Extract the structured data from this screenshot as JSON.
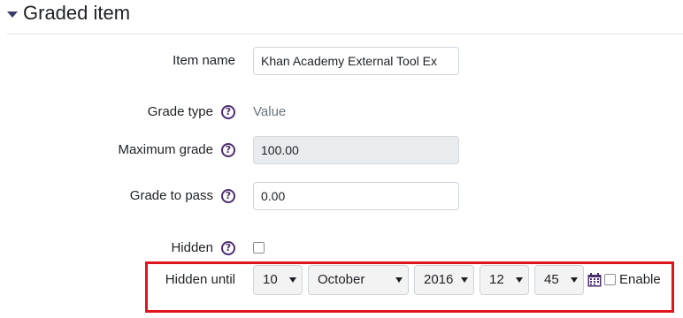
{
  "section": {
    "title": "Graded item"
  },
  "fields": {
    "item_name": {
      "label": "Item name",
      "value": "Khan Academy External Tool Ex"
    },
    "grade_type": {
      "label": "Grade type",
      "value": "Value"
    },
    "maximum_grade": {
      "label": "Maximum grade",
      "value": "100.00"
    },
    "grade_to_pass": {
      "label": "Grade to pass",
      "value": "0.00"
    },
    "hidden": {
      "label": "Hidden",
      "checked": false
    },
    "hidden_until": {
      "label": "Hidden until",
      "day": "10",
      "month": "October",
      "year": "2016",
      "hour": "12",
      "minute": "45",
      "enable_label": "Enable",
      "enabled": false
    }
  },
  "help_icon": "?",
  "colors": {
    "highlight": "#e0141e",
    "help": "#4a2e6e"
  }
}
